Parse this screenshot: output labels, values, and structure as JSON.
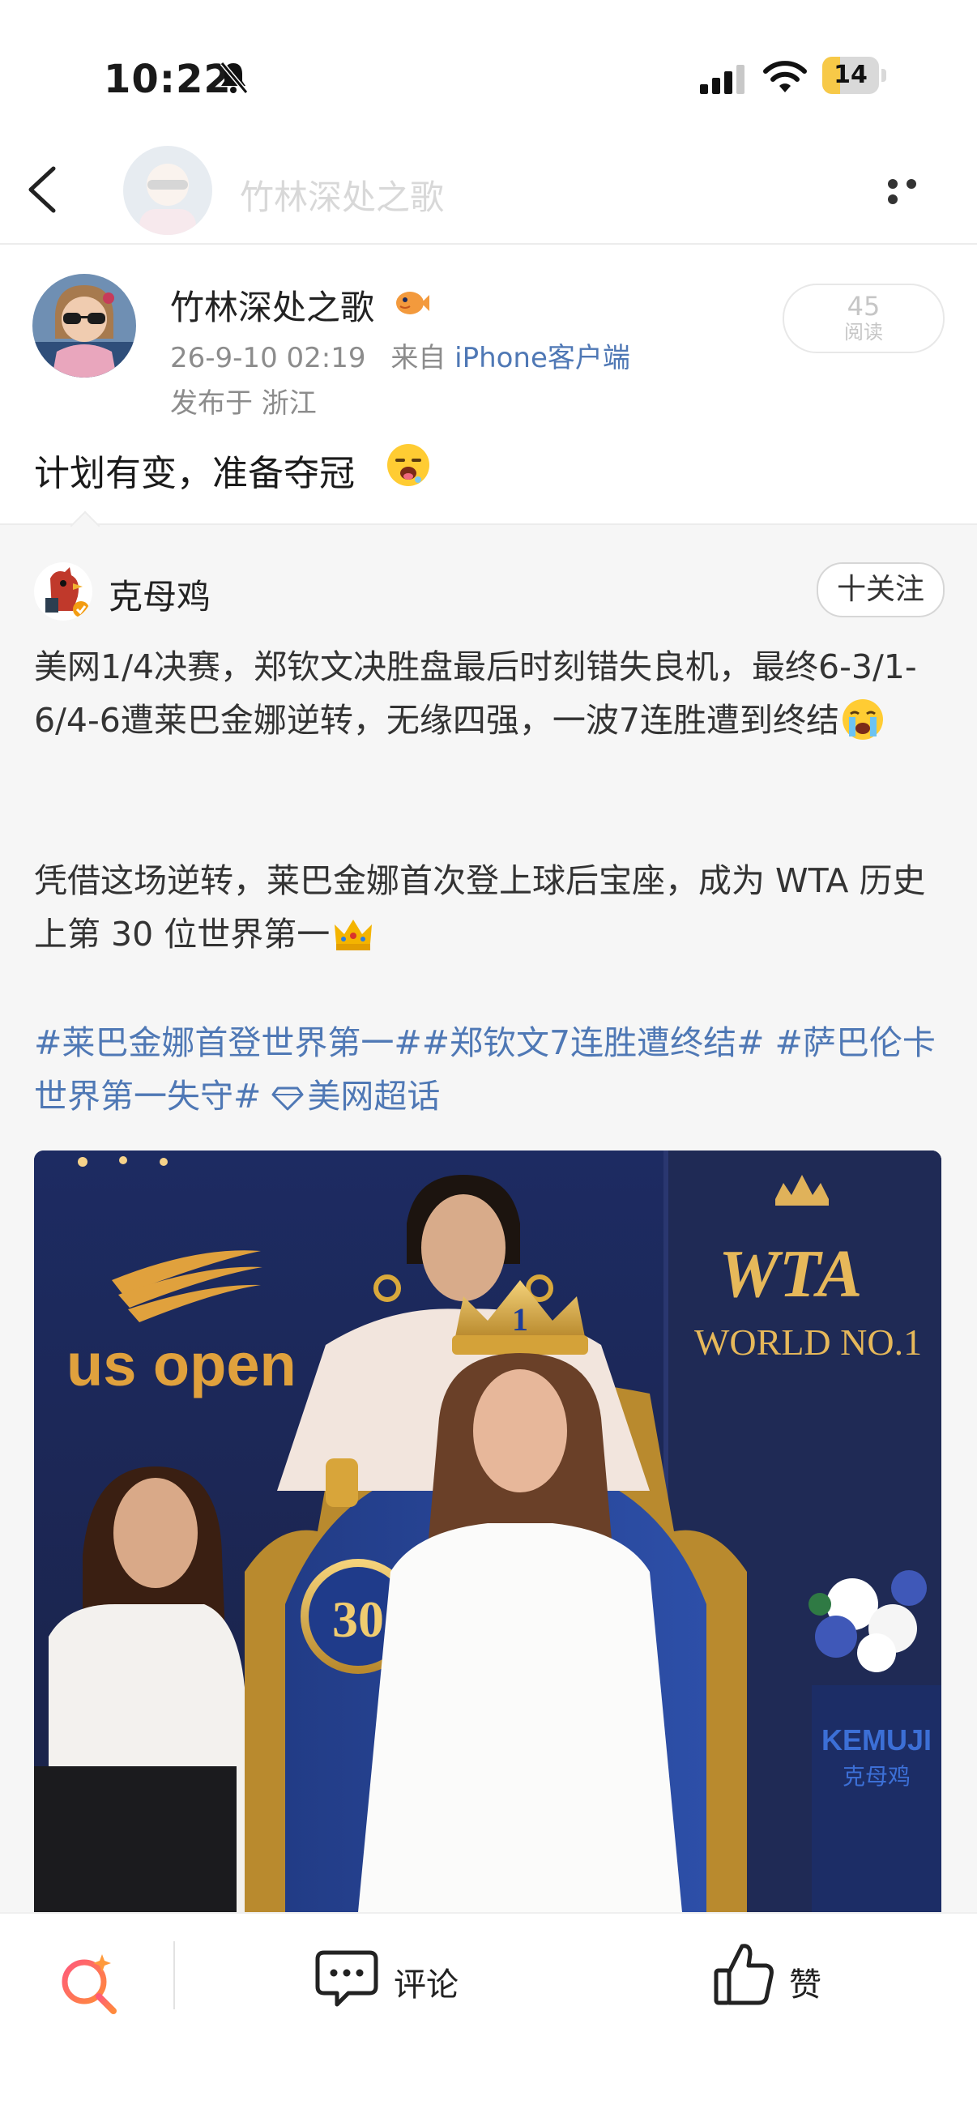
{
  "status_bar": {
    "time": "10:22",
    "battery": "14",
    "icons": [
      "bell-slash-icon",
      "cellular-signal-icon",
      "wifi-icon",
      "battery-icon"
    ]
  },
  "nav": {
    "title": "竹林深处之歌",
    "back_icon": "chevron-left-icon",
    "more_icon": "more-dots-icon"
  },
  "post": {
    "author": "竹林深处之歌",
    "time": "26-9-10 02:19",
    "source_prefix": "来自",
    "source": "iPhone客户端",
    "location": "发布于 浙江",
    "read_count": "45",
    "read_label": "阅读",
    "text": "计划有变，准备夺冠",
    "emoji": "drooling-face-emoji"
  },
  "repost": {
    "author": "克母鸡",
    "follow_label": "十关注",
    "paragraph1": "美网1/4决赛，郑钦文决胜盘最后时刻错失良机，最终6-3/1-6/4-6遭莱巴金娜逆转，无缘四强，一波7连胜遭到终结",
    "paragraph2": "凭借这场逆转，莱巴金娜首次登上球后宝座，成为 WTA 历史上第 30 位世界第一",
    "tags_text": "#莱巴金娜首登世界第一##郑钦文7连胜遭终结# #萨巴伦卡世界第一失守# ",
    "super_topic": "美网超话",
    "photo": {
      "caption_left": "us open",
      "caption_right_1": "WTA",
      "caption_right_2": "WORLD NO.1",
      "seal_number": "30",
      "crown_number": "1",
      "podium_1": "KEMUJI",
      "podium_2": "克母鸡"
    }
  },
  "bottom_bar": {
    "comment_label": "评论",
    "like_label": "赞"
  },
  "colors": {
    "link": "#4f78b5",
    "meta": "#8c8c8c",
    "repost_bg": "#f6f6f6",
    "battery": "#f7c948"
  }
}
